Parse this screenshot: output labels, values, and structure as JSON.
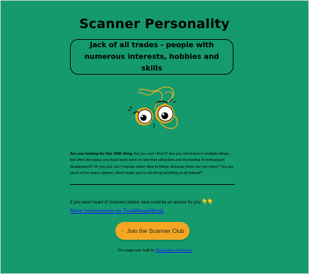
{
  "page": {
    "title": "Scanner Personality",
    "tagline": "Jack of all trades - people with numerous interests, hobbies and skills"
  },
  "intro": {
    "lead_bold": "Are you looking for this ",
    "one_bold": "ONE",
    "thing_bold": " thing",
    "body": ", but you can`t find it? Are you interested in multiple things, but often the topics you have been keen on lost their attraction and the feeling of enthusiasm disappeared? Or you just can`t choose which idea to follow, because there are too many? You are stuck of too many options, which leads you to not doing anything at all instead?"
  },
  "answer": {
    "pre": "If you never heard of ",
    "scanners_italic": "Scanners",
    "post": " before, here could be an answer for you ",
    "hands_icon": "👇👇"
  },
  "links": {
    "more_info": "More informations on TwoMinuteBreak"
  },
  "cta": {
    "icon": "sparkle-icon",
    "label": "Join the Scanner Club"
  },
  "footer": {
    "text": "This page was built by ",
    "author": "Magdalena Zieliewicz"
  },
  "colors": {
    "background": "#159a6e",
    "button": "#f5a623",
    "link": "#1a1aee"
  }
}
